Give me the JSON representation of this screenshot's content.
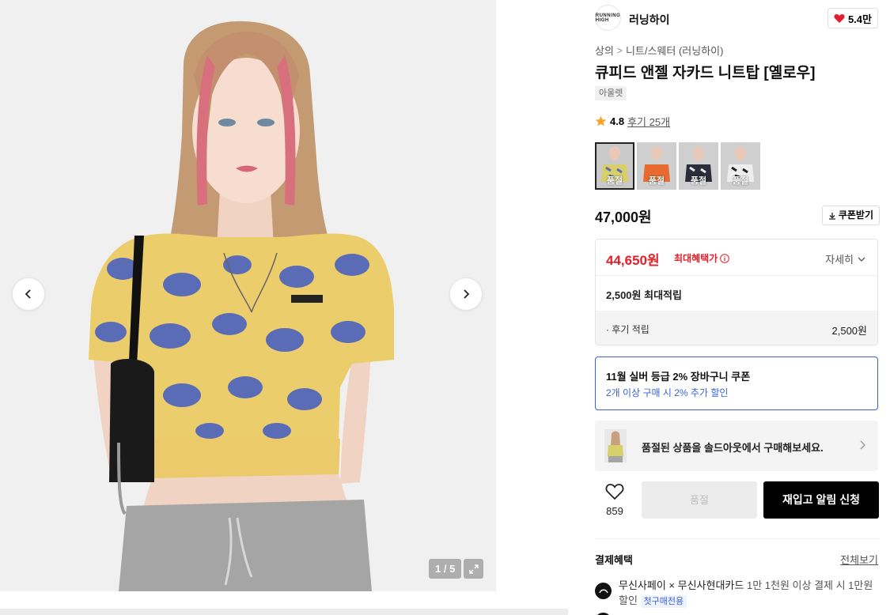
{
  "gallery": {
    "counter": "1 / 5"
  },
  "brand": {
    "logo_text": "RUNNING HIGH",
    "name": "러닝하이",
    "likes": "5.4만"
  },
  "breadcrumb": {
    "category": "상의",
    "separator": ">",
    "subcategory": "니트/스웨터 (러닝하이)"
  },
  "product": {
    "title": "큐피드 앤젤 자카드 니트탑 [옐로우]",
    "tag": "아울렛",
    "rating": "4.8",
    "reviews": "후기 25개",
    "price": "47,000원",
    "coupon_label": "쿠폰받기"
  },
  "swatches": [
    {
      "label": "품절",
      "color": "#d8cf6a"
    },
    {
      "label": "품절",
      "color": "#e96a2e"
    },
    {
      "label": "품절",
      "color": "#2b2e3a"
    },
    {
      "label": "품절",
      "color": "#e8e8e8"
    }
  ],
  "benefit": {
    "max_price": "44,650원",
    "max_label": "최대혜택가",
    "detail": "자세히",
    "points": "2,500원 최대적립",
    "review_label": "· 후기 적립",
    "review_value": "2,500원"
  },
  "cart_coupon": {
    "title": "11월 실버 등급 2% 장바구니 쿠폰",
    "subtitle": "2개 이상 구매 시 2% 추가 할인"
  },
  "soldout_banner": {
    "text": "품절된 상품을 솔드아웃에서 구매해보세요."
  },
  "actions": {
    "wish_count": "859",
    "soldout": "품절",
    "restock": "재입고 알림 신청"
  },
  "payment": {
    "title": "결제혜택",
    "view_all": "전체보기",
    "item1_main": "무신사페이 × 무신사현대카드",
    "item1_desc": "1만 1천원 이상 결제 시 1만원 할인",
    "item1_badge": "첫구매전용"
  },
  "colors": {
    "accent_red": "#e51d26",
    "accent_blue": "#3b63d6",
    "heart": "#e0202e",
    "star": "#f5a623"
  }
}
